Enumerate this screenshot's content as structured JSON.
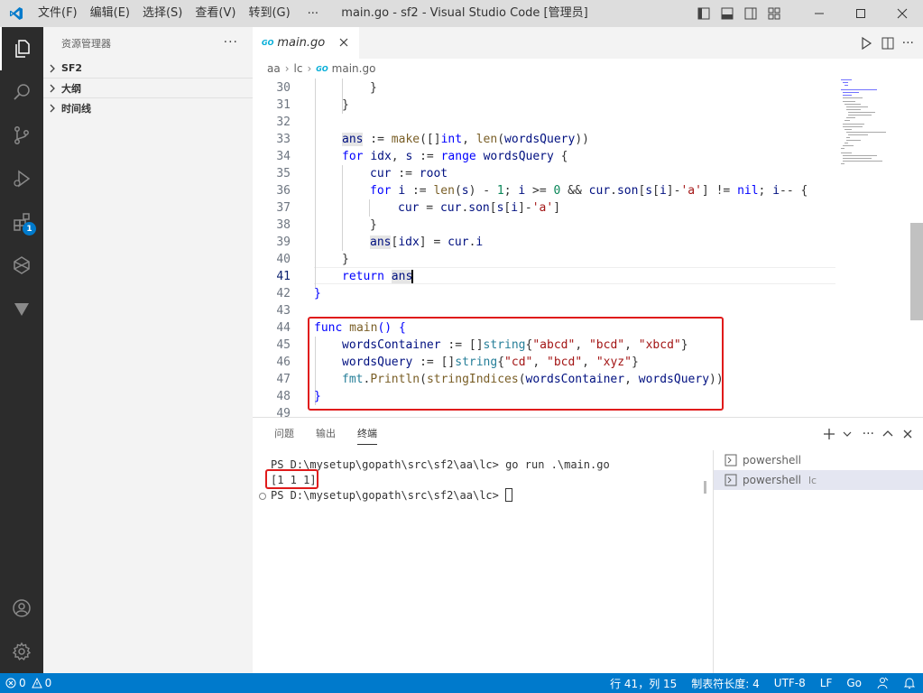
{
  "menu": [
    "文件(F)",
    "编辑(E)",
    "选择(S)",
    "查看(V)",
    "转到(G)"
  ],
  "menu_more": "···",
  "window_title": "main.go - sf2 - Visual Studio Code [管理员]",
  "activity": {
    "extensions_badge": "1"
  },
  "sidebar": {
    "title": "资源管理器",
    "more": "···",
    "sections": [
      "SF2",
      "大纲",
      "时间线"
    ]
  },
  "tab": {
    "go_badge": "GO",
    "label": "main.go"
  },
  "breadcrumb": [
    "aa",
    "lc",
    "main.go"
  ],
  "breadcrumb_go_badge": "GO",
  "editor": {
    "current_line": "41",
    "lines": [
      {
        "n": "30",
        "text": "}"
      },
      {
        "n": "31",
        "text": "}"
      },
      {
        "n": "32",
        "text": ""
      },
      {
        "n": "33",
        "text": "ans := make([]int, len(wordsQuery))"
      },
      {
        "n": "34",
        "text": "for idx, s := range wordsQuery {"
      },
      {
        "n": "35",
        "text": "cur := root"
      },
      {
        "n": "36",
        "text": "for i := len(s) - 1; i >= 0 && cur.son[s[i]-'a'] != nil; i-- {"
      },
      {
        "n": "37",
        "text": "cur = cur.son[s[i]-'a']"
      },
      {
        "n": "38",
        "text": "}"
      },
      {
        "n": "39",
        "text": "ans[idx] = cur.i"
      },
      {
        "n": "40",
        "text": "}"
      },
      {
        "n": "41",
        "text": "return ans"
      },
      {
        "n": "42",
        "text": "}"
      },
      {
        "n": "43",
        "text": ""
      },
      {
        "n": "44",
        "text": "func main() {"
      },
      {
        "n": "45",
        "text": "wordsContainer := []string{\"abcd\", \"bcd\", \"xbcd\"}"
      },
      {
        "n": "46",
        "text": "wordsQuery := []string{\"cd\", \"bcd\", \"xyz\"}"
      },
      {
        "n": "47",
        "text": "fmt.Println(stringIndices(wordsContainer, wordsQuery))"
      },
      {
        "n": "48",
        "text": "}"
      },
      {
        "n": "49",
        "text": ""
      }
    ]
  },
  "panel": {
    "tabs": [
      "问题",
      "输出",
      "终端"
    ],
    "active_tab": "终端",
    "more": "···",
    "terminal": [
      "PS D:\\mysetup\\gopath\\src\\sf2\\aa\\lc> go run .\\main.go",
      "[1 1 1]",
      "PS D:\\mysetup\\gopath\\src\\sf2\\aa\\lc> "
    ],
    "terminals": [
      {
        "name": "powershell",
        "sub": ""
      },
      {
        "name": "powershell",
        "sub": "lc"
      }
    ]
  },
  "status": {
    "errors": "0",
    "warnings": "0",
    "position": "行 41，列 15",
    "tab_size": "制表符长度: 4",
    "encoding": "UTF-8",
    "eol": "LF",
    "language": "Go"
  },
  "colors": {
    "accent": "#007acc",
    "highlight_box": "#e01b1b"
  }
}
